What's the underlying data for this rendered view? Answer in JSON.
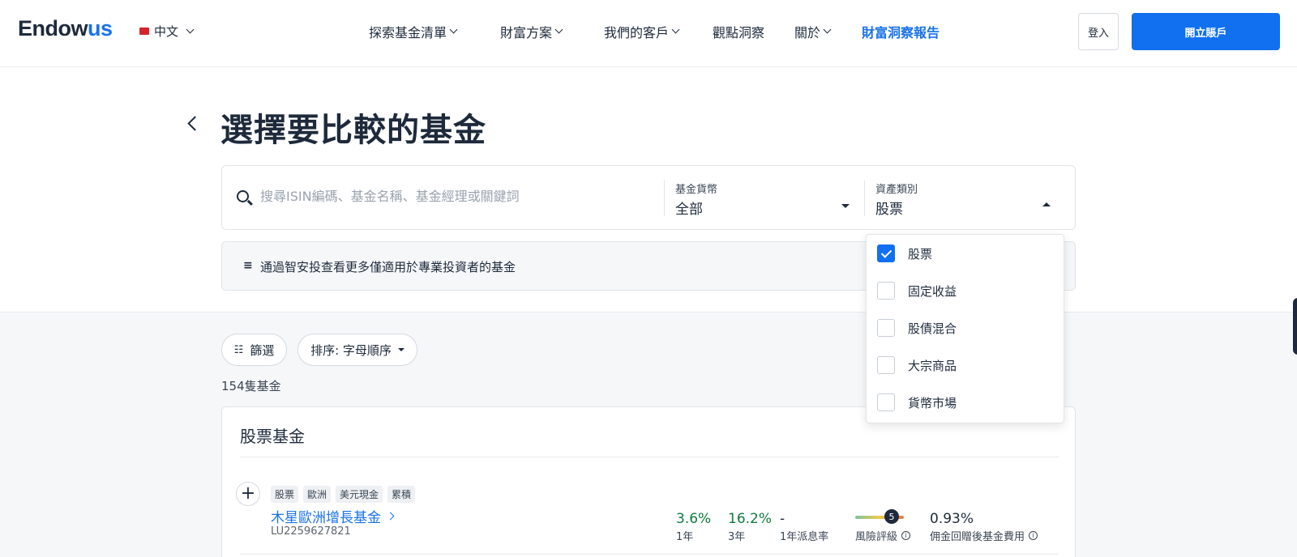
{
  "header": {
    "logo_main": "Endow",
    "logo_accent": "us",
    "language": "中文",
    "nav": [
      {
        "label": "探索基金清單"
      },
      {
        "label": "財富方案"
      },
      {
        "label": "我們的客戶"
      },
      {
        "label": "觀點洞察"
      },
      {
        "label": "關於"
      },
      {
        "label": "財富洞察報告"
      }
    ],
    "login_label": "登入",
    "open_account_label": "開立賬戶"
  },
  "page": {
    "title": "選擇要比較的基金"
  },
  "search": {
    "placeholder": "搜尋ISIN編碼、基金名稱、基金經理或關鍵詞",
    "currency_label": "基金貨幣",
    "currency_value": "全部",
    "asset_label": "資產類別",
    "asset_value": "股票"
  },
  "banner": {
    "icon": "≡",
    "text": "通過智安投查看更多僅適用於專業投資者的基金"
  },
  "toolbar": {
    "filter_label": "篩選",
    "sort_label": "排序: 字母順序",
    "count": "154隻基金"
  },
  "dropdown": {
    "options": [
      {
        "label": "股票",
        "checked": true
      },
      {
        "label": "固定收益",
        "checked": false
      },
      {
        "label": "股債混合",
        "checked": false
      },
      {
        "label": "大宗商品",
        "checked": false
      },
      {
        "label": "貨幣市場",
        "checked": false
      }
    ]
  },
  "card": {
    "title": "股票基金",
    "fund": {
      "tags": [
        "股票",
        "歐洲",
        "美元現金",
        "累積"
      ],
      "name": "木星歐洲增長基金",
      "isin": "LU2259627821",
      "return_1y": "3.6%",
      "return_1y_label": "1年",
      "return_3y": "16.2%",
      "return_3y_label": "3年",
      "dividend": "-",
      "dividend_label": "1年派息率",
      "risk_rating": "5",
      "risk_label": "風險評級",
      "fee": "0.93%",
      "fee_label": "佣金回贈後基金費用"
    }
  },
  "colors": {
    "accent": "#1070f0",
    "positive": "#0f7a3e",
    "text": "#1e2a3b"
  }
}
